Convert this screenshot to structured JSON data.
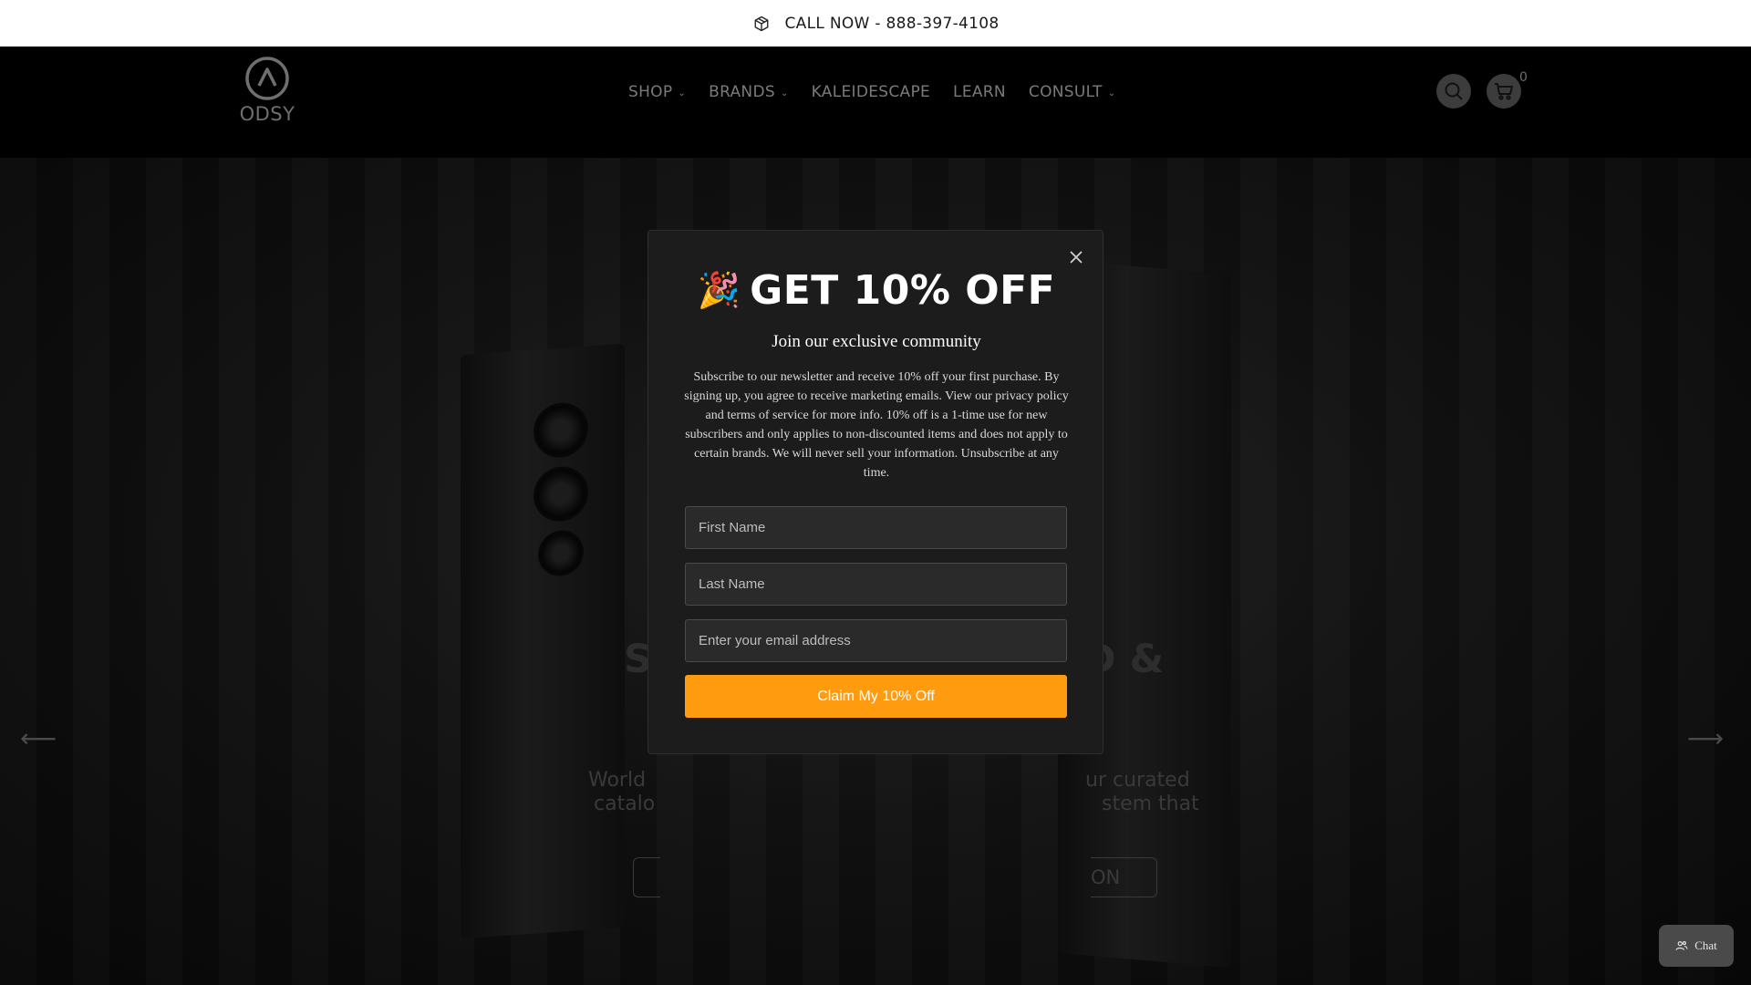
{
  "announcement": {
    "text": "CALL NOW - 888-397-4108",
    "icon": "cube-icon"
  },
  "header": {
    "logo_text": "ODSY",
    "nav": [
      {
        "label": "SHOP",
        "has_dropdown": true
      },
      {
        "label": "BRANDS",
        "has_dropdown": true
      },
      {
        "label": "KALEIDESCAPE",
        "has_dropdown": false
      },
      {
        "label": "LEARN",
        "has_dropdown": false
      },
      {
        "label": "CONSUL T",
        "has_dropdown": true
      }
    ],
    "cart_count": "0"
  },
  "hero": {
    "title_left": "S",
    "title_right": "D &",
    "sub_left": [
      "World",
      "catalo"
    ],
    "sub_right": [
      "ur curated",
      "stem that"
    ],
    "button_right": "ON"
  },
  "modal": {
    "emoji": "🎉",
    "title": "GET 10% OFF",
    "subtitle": "Join our exclusive community",
    "body": "Subscribe to our newsletter and receive 10% off your first purchase. By signing up, you agree to receive marketing emails. View our privacy policy and terms of service for more info. 10% off is a 1-time use for new subscribers and only applies to non-discounted items and does not apply to certain brands. We will never sell your information. Unsubscribe at any time.",
    "first_name_placeholder": "First Name",
    "last_name_placeholder": "Last Name",
    "email_placeholder": "Enter your email address",
    "cta": "Claim My 10% Off"
  },
  "chat": {
    "label": "Chat"
  },
  "colors": {
    "accent": "#ff9b0f",
    "modal_bg": "#1c1c1c"
  }
}
